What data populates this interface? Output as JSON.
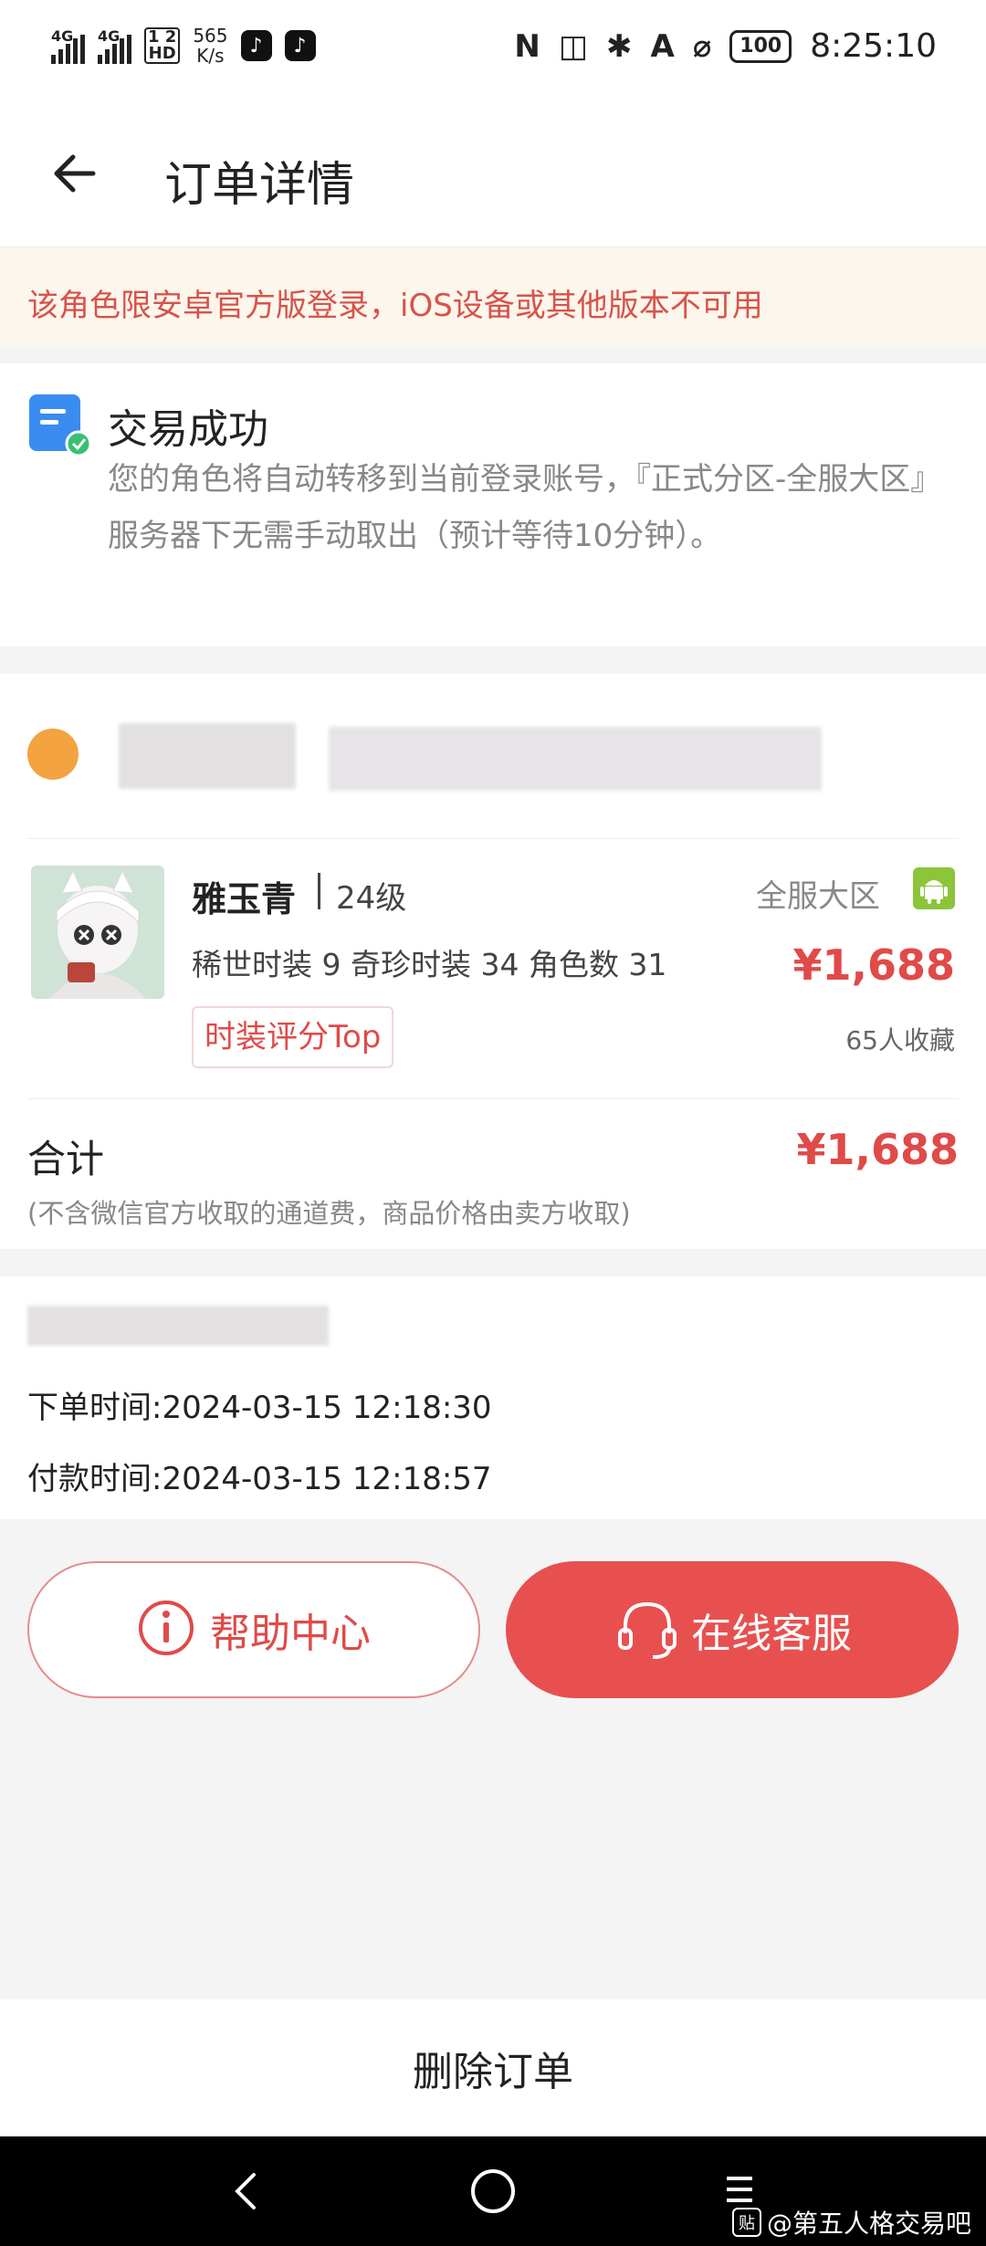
{
  "status_bar": {
    "sim1": "4G",
    "sim2": "4G",
    "hd_badge": "1 2\nHD",
    "net_speed": "565\nK/s",
    "battery": "100",
    "time": "8:25:10"
  },
  "header": {
    "title": "订单详情"
  },
  "notice": {
    "text": "该角色限安卓官方版登录，iOS设备或其他版本不可用"
  },
  "status": {
    "title": "交易成功",
    "description": "您的角色将自动转移到当前登录账号，『正式分区-全服大区』服务器下无需手动取出（预计等待10分钟）。"
  },
  "product": {
    "name": "雅玉青",
    "level": "24级",
    "server": "全服大区",
    "stats": "稀世时装 9  奇珍时装 34  角色数 31",
    "price": "¥1,688",
    "tag": "时装评分Top",
    "favorites": "65人收藏"
  },
  "total": {
    "label": "合计",
    "price": "¥1,688",
    "note": "(不含微信官方收取的通道费，商品价格由卖方收取)"
  },
  "order_info": {
    "order_time": "下单时间:2024-03-15 12:18:30",
    "pay_time": "付款时间:2024-03-15 12:18:57"
  },
  "actions": {
    "help": "帮助中心",
    "customer_service": "在线客服",
    "delete": "删除订单"
  },
  "watermark": {
    "logo": "贴",
    "text": "@第五人格交易吧"
  },
  "colors": {
    "accent": "#e85050",
    "price": "#e04a48",
    "notice_bg": "#fdf6ec",
    "android": "#8cc43a"
  }
}
